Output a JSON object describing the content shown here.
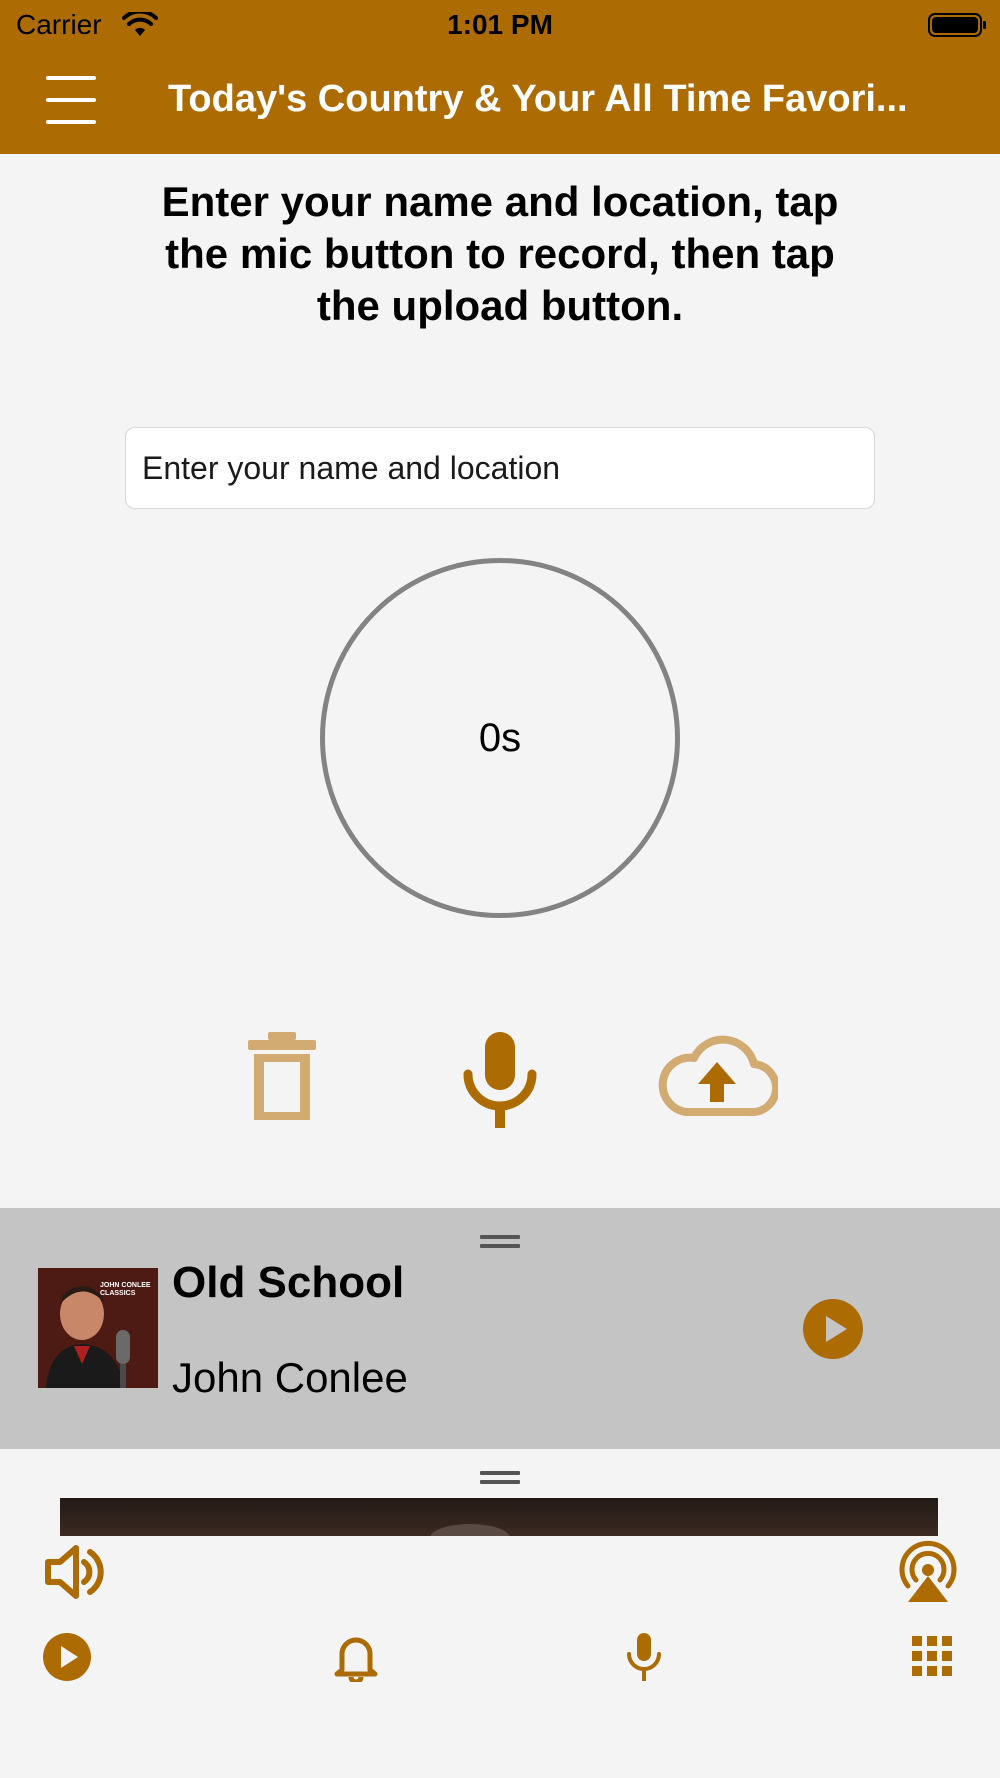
{
  "status_bar": {
    "carrier": "Carrier",
    "time": "1:01 PM"
  },
  "nav": {
    "title": "Today's Country & Your All Time Favori..."
  },
  "recorder": {
    "instructions": "Enter your name and location, tap the mic button to record, then tap the upload button.",
    "name_placeholder": "Enter your name and location",
    "timer": "0s"
  },
  "now_playing": {
    "title": "Old School",
    "artist": "John Conlee",
    "album_art_text": "JOHN CONLEE CLASSICS"
  },
  "icons": {
    "menu": "hamburger-icon",
    "delete": "trash-icon",
    "record": "microphone-icon",
    "upload": "cloud-upload-icon",
    "volume": "speaker-icon",
    "airplay": "airplay-icon",
    "play": "play-icon",
    "alerts": "bell-icon",
    "mic_tab": "microphone-icon",
    "grid": "grid-icon"
  },
  "colors": {
    "brand": "#ad6b04",
    "brand_light": "#d2ab73",
    "player_bg": "#c4c4c4",
    "background": "#f4f4f4"
  }
}
